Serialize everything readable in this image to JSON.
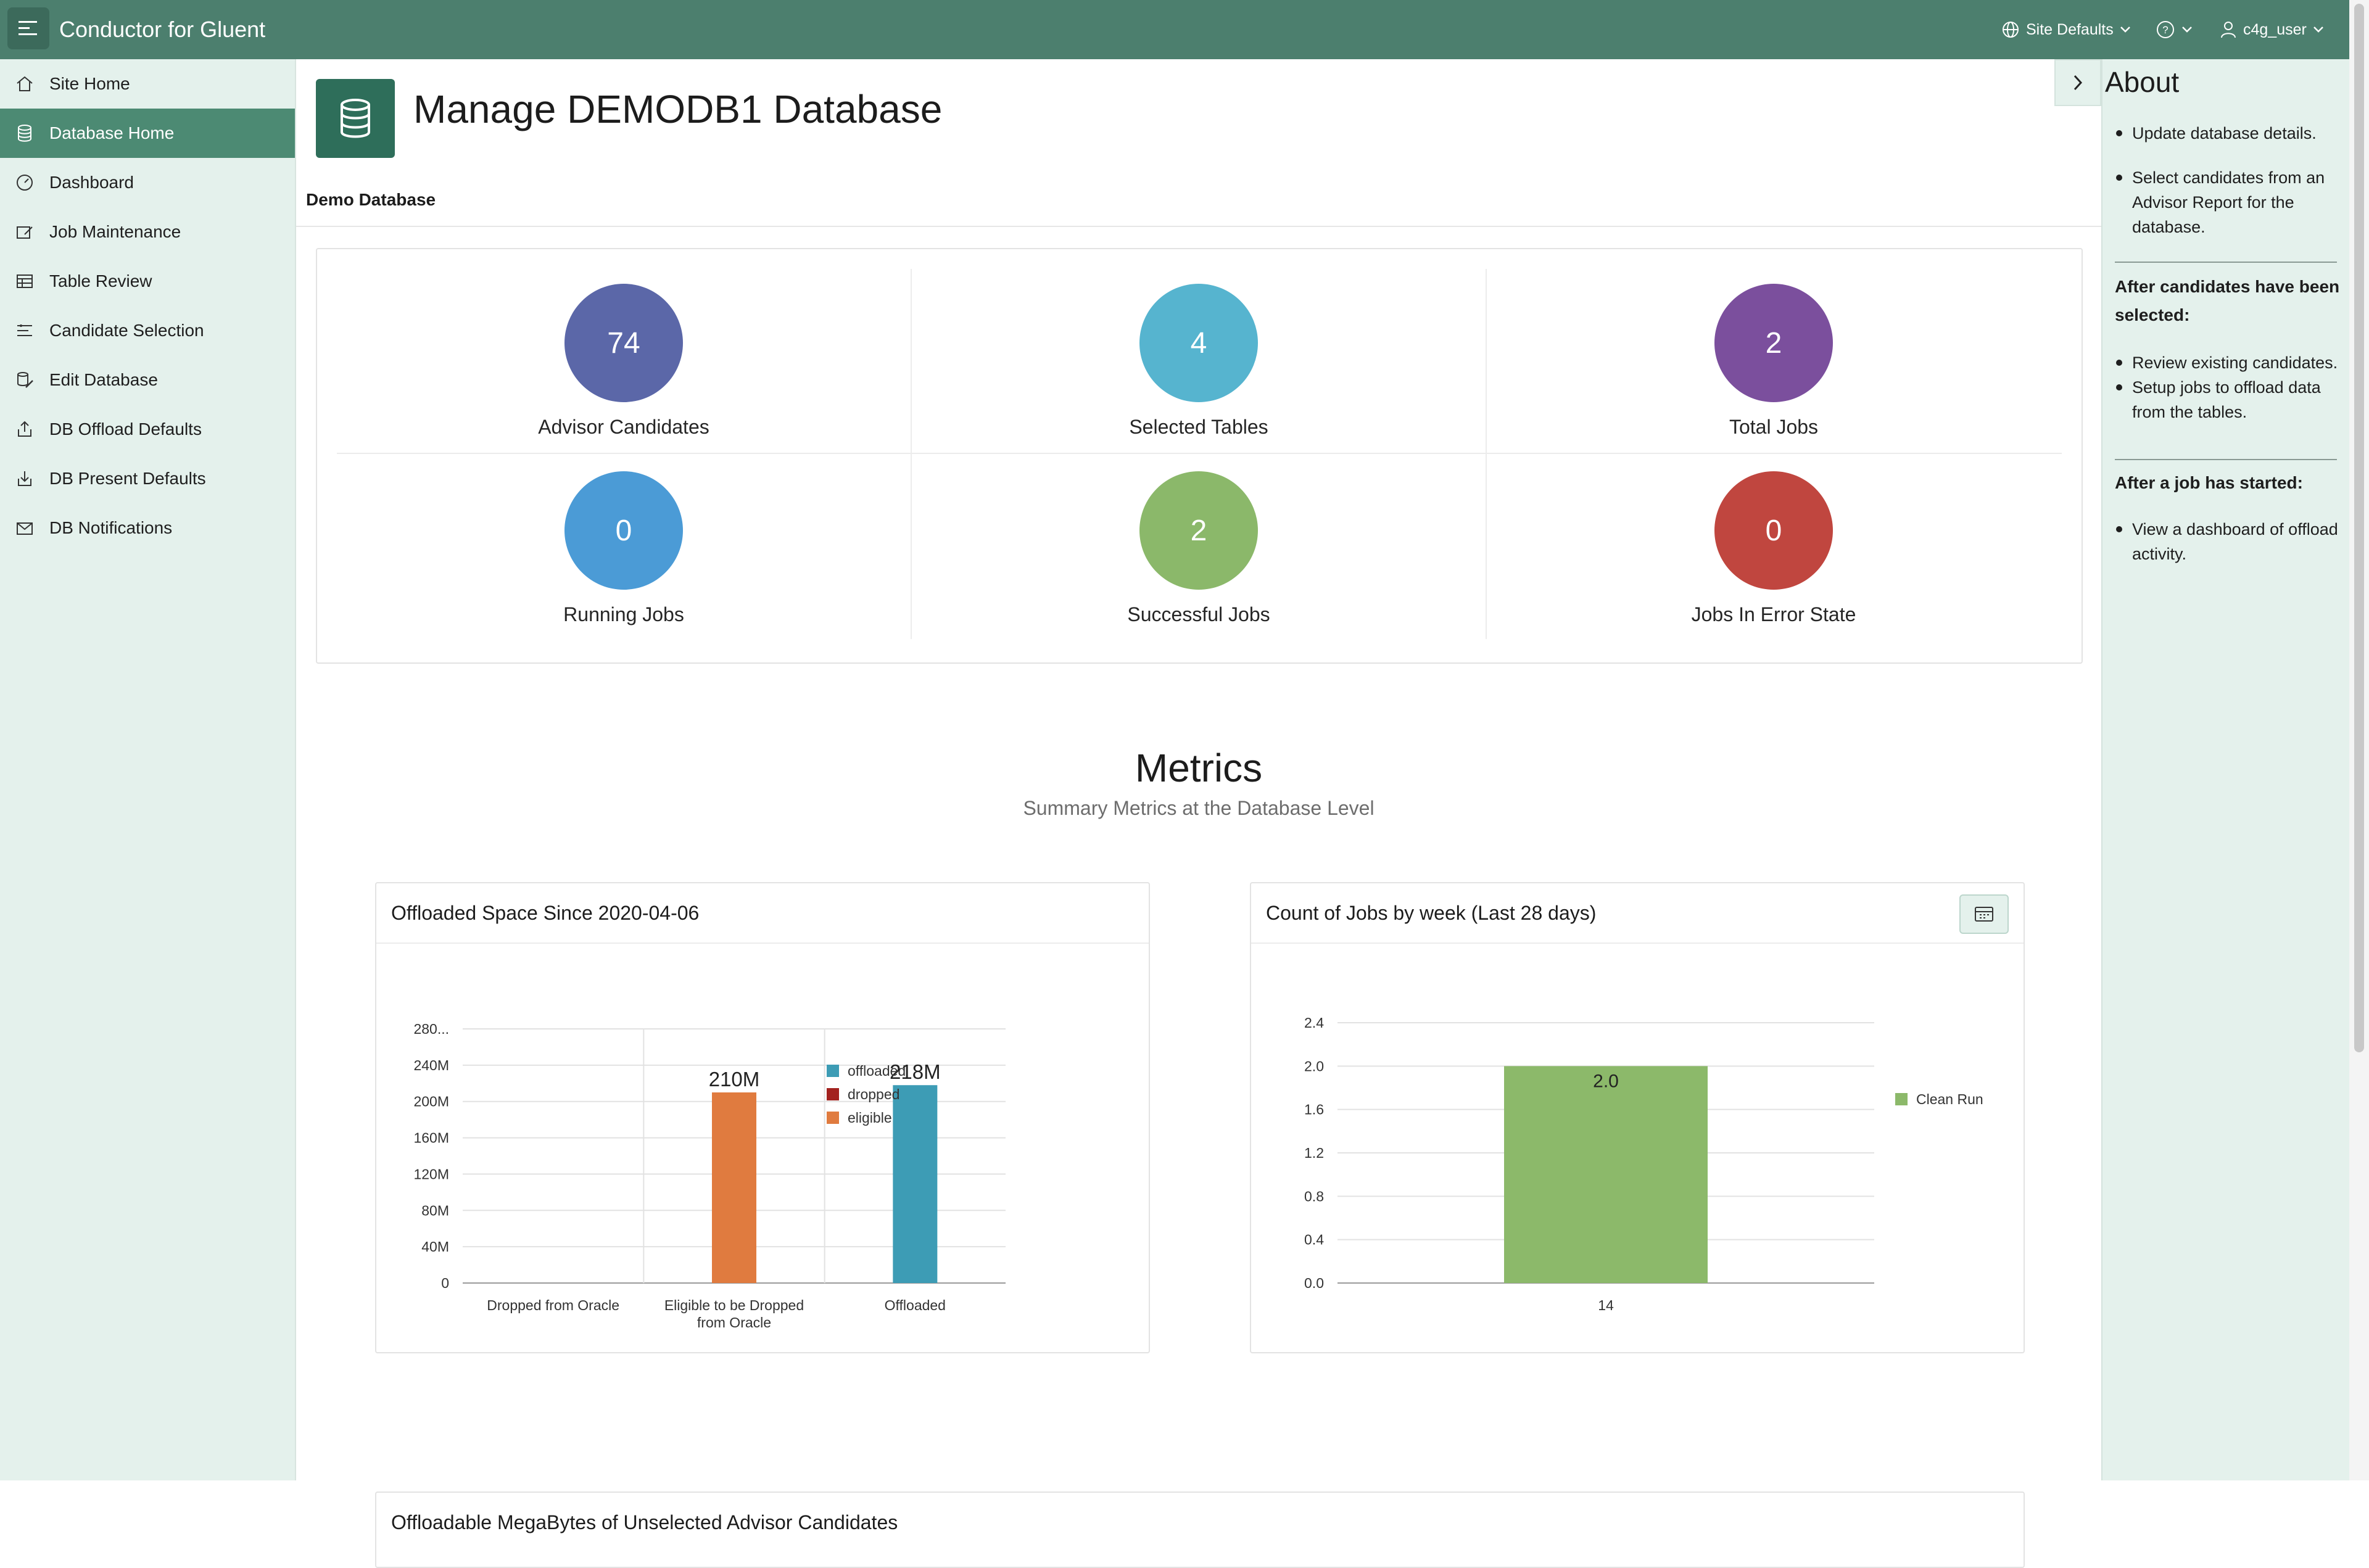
{
  "app": {
    "title": "Conductor for Gluent"
  },
  "header": {
    "site_defaults_label": "Site Defaults",
    "help_icon": "help-icon",
    "user_label": "c4g_user"
  },
  "sidebar": {
    "items": [
      {
        "label": "Site Home",
        "icon": "home-icon",
        "active": false
      },
      {
        "label": "Database Home",
        "icon": "database-icon",
        "active": true
      },
      {
        "label": "Dashboard",
        "icon": "gauge-icon",
        "active": false
      },
      {
        "label": "Job Maintenance",
        "icon": "edit-job-icon",
        "active": false
      },
      {
        "label": "Table Review",
        "icon": "table-icon",
        "active": false
      },
      {
        "label": "Candidate Selection",
        "icon": "filter-list-icon",
        "active": false
      },
      {
        "label": "Edit Database",
        "icon": "database-edit-icon",
        "active": false
      },
      {
        "label": "DB Offload Defaults",
        "icon": "upload-icon",
        "active": false
      },
      {
        "label": "DB Present Defaults",
        "icon": "download-icon",
        "active": false
      },
      {
        "label": "DB Notifications",
        "icon": "mail-check-icon",
        "active": false
      }
    ]
  },
  "main": {
    "page_title": "Manage DEMODB1 Database",
    "region_title": "Demo Database",
    "badges": [
      {
        "value": "74",
        "label": "Advisor Candidates",
        "color": "#5b67a8"
      },
      {
        "value": "4",
        "label": "Selected Tables",
        "color": "#56b4cf"
      },
      {
        "value": "2",
        "label": "Total Jobs",
        "color": "#7b4f9d"
      },
      {
        "value": "0",
        "label": "Running Jobs",
        "color": "#4b9bd6"
      },
      {
        "value": "2",
        "label": "Successful Jobs",
        "color": "#8bb86a"
      },
      {
        "value": "0",
        "label": "Jobs In Error State",
        "color": "#c0463f"
      }
    ],
    "metrics_title": "Metrics",
    "metrics_subtitle": "Summary Metrics at the Database Level",
    "bottom_card_title": "Offloadable MegaBytes of Unselected Advisor Candidates"
  },
  "chart_data": [
    {
      "type": "bar",
      "title": "Offloaded Space Since 2020-04-06",
      "categories": [
        "Dropped from Oracle",
        "Eligible to be Dropped from Oracle",
        "Offloaded"
      ],
      "category_lines": [
        [
          "Dropped from Oracle"
        ],
        [
          "Eligible to be Dropped",
          "from Oracle"
        ],
        [
          "Offloaded"
        ]
      ],
      "series": [
        {
          "name": "offloaded",
          "color": "#3d9cb5",
          "values": [
            0,
            0,
            218
          ]
        },
        {
          "name": "dropped",
          "color": "#a3221f",
          "values": [
            0,
            0,
            0
          ]
        },
        {
          "name": "eligible",
          "color": "#e07b3f",
          "values": [
            0,
            210,
            0
          ]
        }
      ],
      "data_labels": [
        "",
        "210M",
        "218M"
      ],
      "yticks": [
        "0",
        "40M",
        "80M",
        "120M",
        "160M",
        "200M",
        "240M",
        "280..."
      ],
      "ylim": [
        0,
        280
      ],
      "legend": "right",
      "grid": true
    },
    {
      "type": "bar",
      "title": "Count of Jobs by week (Last 28 days)",
      "categories": [
        "14"
      ],
      "series": [
        {
          "name": "Clean Run",
          "color": "#8cb96a",
          "values": [
            2.0
          ]
        }
      ],
      "data_labels": [
        "2.0"
      ],
      "yticks": [
        "0.0",
        "0.4",
        "0.8",
        "1.2",
        "1.6",
        "2.0",
        "2.4"
      ],
      "ylim": [
        0,
        2.4
      ],
      "legend": "right",
      "grid": true
    }
  ],
  "about": {
    "title": "About",
    "intro_bullets": [
      "Update database details.",
      "Select candidates from an Advisor Report for the database."
    ],
    "section1_heading": "After candidates have been selected:",
    "section1_bullets": [
      "Review existing candidates.",
      "Setup jobs to offload data from the tables."
    ],
    "section2_heading": "After a job has started:",
    "section2_bullets": [
      "View a dashboard of offload activity."
    ]
  }
}
